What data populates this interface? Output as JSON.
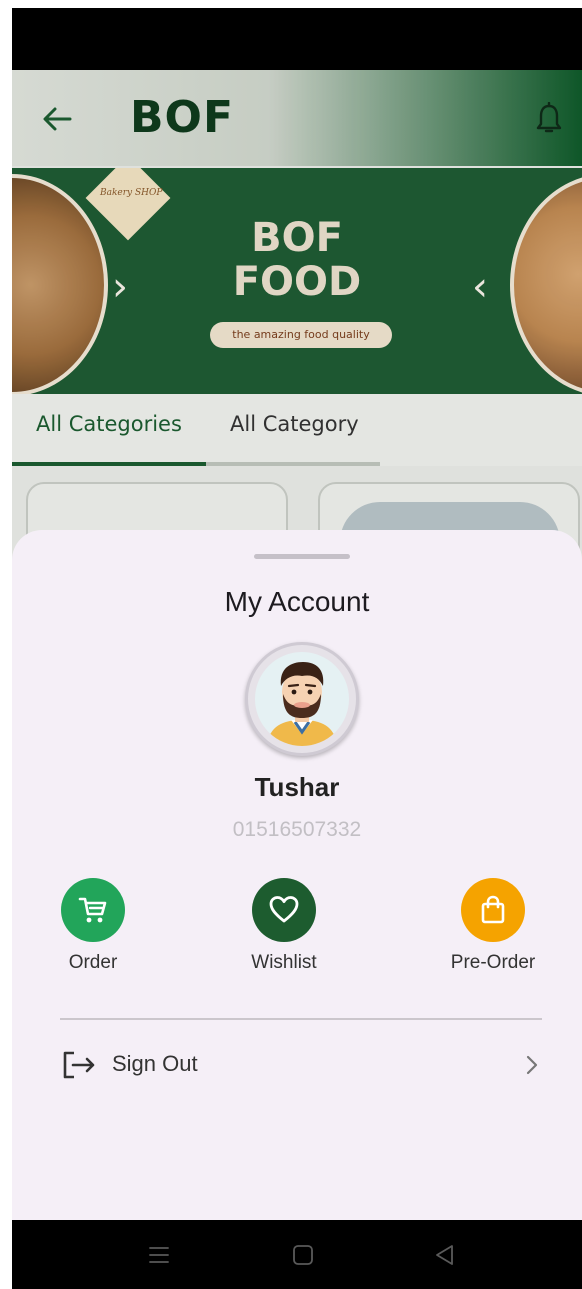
{
  "app_bar": {
    "title": "BOF",
    "back_icon": "arrow-left-icon",
    "bell_icon": "bell-icon"
  },
  "banner": {
    "logo_text": "Bakery SHOP",
    "title_line1": "BOF",
    "title_line2": "FOOD",
    "tagline": "the amazing food quality"
  },
  "tabs": [
    {
      "label": "All Categories",
      "selected": true
    },
    {
      "label": "All Category",
      "selected": false
    }
  ],
  "account_sheet": {
    "title": "My Account",
    "user": {
      "name": "Tushar",
      "phone": "01516507332"
    },
    "actions": [
      {
        "label": "Order",
        "icon": "cart-icon",
        "color": "#22a55a"
      },
      {
        "label": "Wishlist",
        "icon": "heart-icon",
        "color": "#1d5c2f"
      },
      {
        "label": "Pre-Order",
        "icon": "shopping-bag-icon",
        "color": "#f5a300"
      }
    ],
    "sign_out_label": "Sign Out"
  },
  "colors": {
    "primary_green": "#1c5c30",
    "sheet_background": "#f5eff7"
  }
}
